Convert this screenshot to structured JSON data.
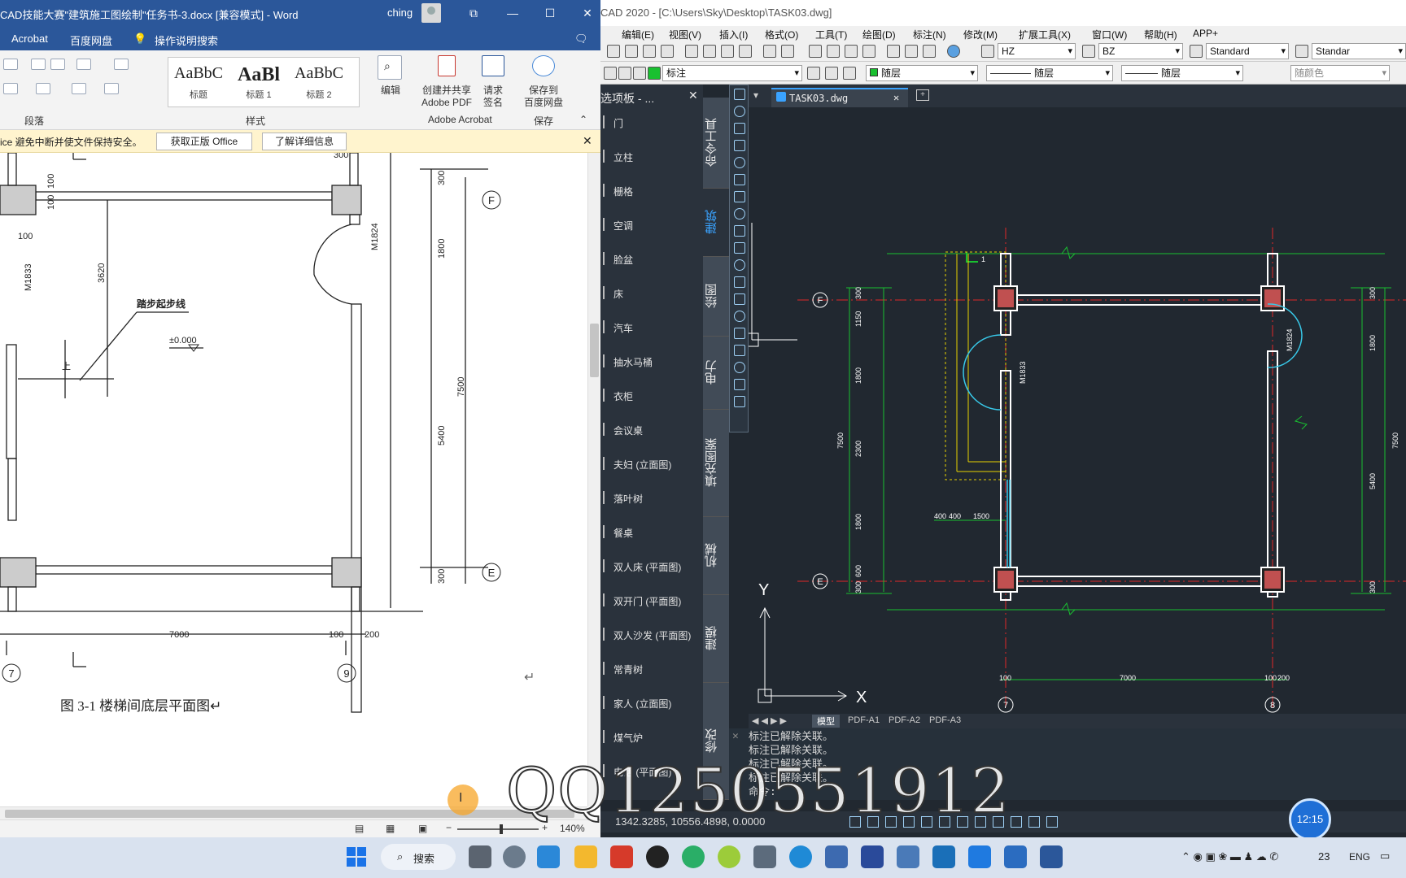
{
  "word": {
    "title": "CAD技能大赛\"建筑施工图绘制\"任务书-3.docx [兼容模式] - Word",
    "user": "ching",
    "tabs": [
      "Acrobat",
      "百度网盘",
      "操作说明搜索"
    ],
    "styles": [
      {
        "preview": "AaBbC",
        "label": "标题"
      },
      {
        "preview": "AaBl",
        "label": "标题 1"
      },
      {
        "preview": "AaBbC",
        "label": "标题 2"
      }
    ],
    "ribbon": {
      "edit": "编辑",
      "create_pdf": "创建并共享\nAdobe PDF",
      "request_sign": "请求\n签名",
      "save_baidu": "保存到\n百度网盘",
      "group_paragraph": "段落",
      "group_styles": "样式",
      "group_acrobat": "Adobe Acrobat",
      "group_save": "保存"
    },
    "message": {
      "text": "ice 避免中断并使文件保持安全。",
      "btn_get": "获取正版 Office",
      "btn_more": "了解详细信息"
    },
    "drawing": {
      "axis_f": "F",
      "axis_e": "E",
      "axis_7": "7",
      "axis_9": "9",
      "m1824": "M1824",
      "m1833": "M1833",
      "stair_line": "踏步起步线",
      "elev": "±0.000",
      "dim_3620": "3620",
      "dim_1800": "1800",
      "dim_7500": "7500",
      "dim_5400": "5400",
      "dim_300a": "300",
      "dim_300b": "300",
      "dim_300c": "300",
      "dim_100a": "100",
      "dim_100b": "100",
      "dim_100c": "100",
      "dim_7000": "7000",
      "dim_100d": "100",
      "dim_200": "200",
      "up": "上",
      "caption": "图 3-1 楼梯间底层平面图↵"
    },
    "zoom": "140%"
  },
  "cad": {
    "title": "CAD 2020 - [C:\\Users\\Sky\\Desktop\\TASK03.dwg]",
    "menu": [
      "编辑(E)",
      "视图(V)",
      "插入(I)",
      "格式(O)",
      "工具(T)",
      "绘图(D)",
      "标注(N)",
      "修改(M)",
      "扩展工具(X)",
      "窗口(W)",
      "帮助(H)",
      "APP+"
    ],
    "toolbar": {
      "textstyle": "HZ",
      "dimstyle": "BZ",
      "tablestyle": "Standard",
      "mlstyle": "Standar",
      "layer": "标注",
      "color": "随层",
      "linetype": "随层",
      "lineweight": "随层",
      "plotstyle": "随颜色"
    },
    "palette_title": "选项板 - ...",
    "palette_items": [
      "门",
      "立柱",
      "栅格",
      "空调",
      "脸盆",
      "床",
      "汽车",
      "抽水马桶",
      "衣柜",
      "会议桌",
      "夫妇 (立面图)",
      "落叶树",
      "餐桌",
      "双人床 (平面图)",
      "双开门 (平面图)",
      "双人沙发 (平面图)",
      "常青树",
      "家人 (立面图)",
      "煤气炉",
      "电话 (平面图)"
    ],
    "palette_tabs": [
      "命令工具",
      "建筑",
      "绘图",
      "电力",
      "填充图案",
      "机械",
      "建模",
      "修改"
    ],
    "file_tab": "TASK03.dwg",
    "layouts": [
      "模型",
      "PDF-A1",
      "PDF-A2",
      "PDF-A3"
    ],
    "cmd_lines": [
      "标注已解除关联。",
      "标注已解除关联。",
      "标注已解除关联。",
      "标注已解除关联。",
      "命令:"
    ],
    "coords": "1342.3285, 10556.4898, 0.0000",
    "drawing": {
      "axis_f": "F",
      "axis_e": "E",
      "axis_7": "7",
      "axis_8": "8",
      "m1824": "M1824",
      "m1833": "M1833",
      "dim_7000": "7000",
      "dim_100": "100",
      "dim_100b": "100",
      "dim_200": "200",
      "dim_400a": "400",
      "dim_400b": "400",
      "dim_1500": "1500",
      "dim_300a": "300",
      "dim_1150": "1150",
      "dim_1800a": "1800",
      "dim_2300": "2300",
      "dim_1800b": "1800",
      "dim_600": "600",
      "dim_300b": "300",
      "dim_7500": "7500",
      "r_300a": "300",
      "r_1800": "1800",
      "r_5400": "5400",
      "r_300b": "300",
      "r_7500": "7500",
      "marker1": "1",
      "axis_y": "Y",
      "axis_x": "X"
    }
  },
  "taskbar": {
    "search": "搜索",
    "lang": "ENG",
    "date_fragment": "23"
  },
  "watermark": "QQ1250551912",
  "clock_bubble": "12:15"
}
